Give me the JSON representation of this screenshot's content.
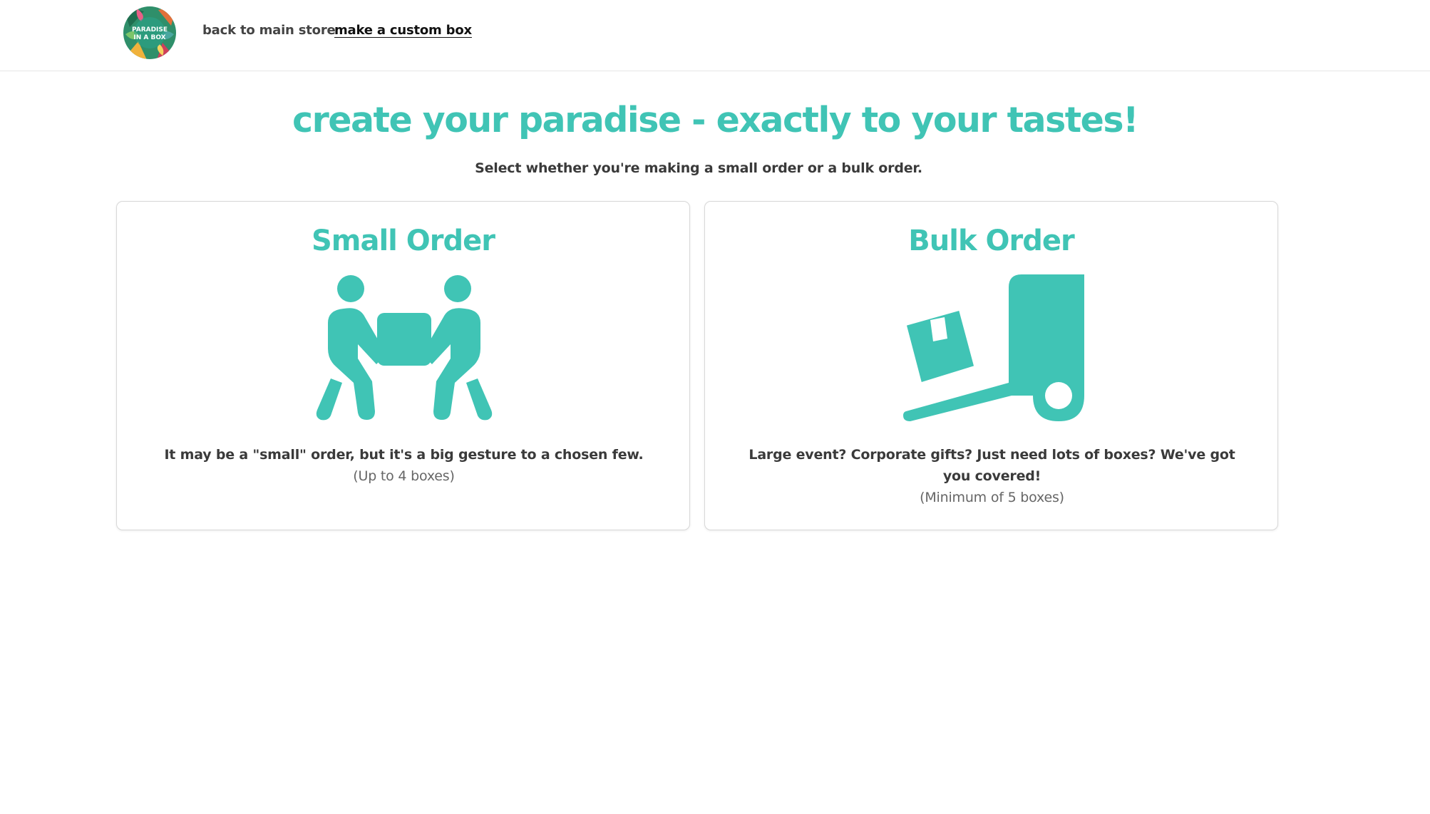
{
  "header": {
    "logo_text_line1": "PARADISE",
    "logo_text_line2": "IN A BOX",
    "nav": {
      "back_label": "back to main store",
      "custom_label": "make a custom box"
    }
  },
  "main": {
    "title": "create your paradise - exactly to your tastes!",
    "subtitle": "Select whether you're making a small order or a bulk order."
  },
  "options": {
    "small": {
      "title": "Small Order",
      "description": "It may be a \"small\" order, but it's a big gesture to a chosen few.",
      "note": "(Up to 4 boxes)",
      "icon": "people-carrying-box-icon"
    },
    "bulk": {
      "title": "Bulk Order",
      "description": "Large event? Corporate gifts? Just need lots of boxes? We've got you covered!",
      "note": "(Minimum of 5 boxes)",
      "icon": "dolly-box-icon"
    }
  },
  "colors": {
    "accent": "#40c4b5",
    "text": "#3a3a3a",
    "muted": "#666666",
    "border": "#d8d8d8"
  }
}
